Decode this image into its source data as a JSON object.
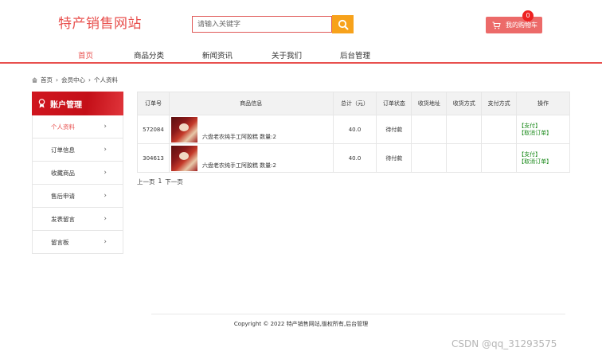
{
  "header": {
    "site_title": "特产销售网站",
    "search_placeholder": "请输入关键字",
    "cart_label": "我的购物车",
    "cart_count": "0"
  },
  "nav": [
    "首页",
    "商品分类",
    "新闻资讯",
    "关于我们",
    "后台管理"
  ],
  "breadcrumb": [
    "首页",
    "会员中心",
    "个人资料"
  ],
  "sidebar": {
    "title": "账户管理",
    "items": [
      "个人资料",
      "订单信息",
      "收藏商品",
      "售后申请",
      "发表留言",
      "留言板"
    ]
  },
  "orders": {
    "headers": [
      "订单号",
      "商品信息",
      "总计（元）",
      "订单状态",
      "收货地址",
      "收货方式",
      "支付方式",
      "操作"
    ],
    "rows": [
      {
        "id": "572084",
        "product": "六盘老农纯手工阿胶糕 数量:2",
        "total": "40.0",
        "status": "待付款",
        "address": "",
        "delivery": "",
        "payment": "",
        "actions": [
          "【支付】",
          "【取消订单】"
        ]
      },
      {
        "id": "304613",
        "product": "六盘老农纯手工阿胶糕 数量:2",
        "total": "40.0",
        "status": "待付款",
        "address": "",
        "delivery": "",
        "payment": "",
        "actions": [
          "【支付】",
          "【取消订单】"
        ]
      }
    ]
  },
  "pager": {
    "prev": "上一页",
    "current": "1",
    "next": "下一页"
  },
  "footer": "Copyright © 2022 特产销售网站,版权所有,后台管理",
  "watermark": "CSDN @qq_31293575",
  "colors": {
    "accent": "#e8504e",
    "search_button": "#f7a21b",
    "cart": "#ec6a69",
    "sidebar_header": "#d0161f",
    "action_link": "#1b8a1b"
  }
}
